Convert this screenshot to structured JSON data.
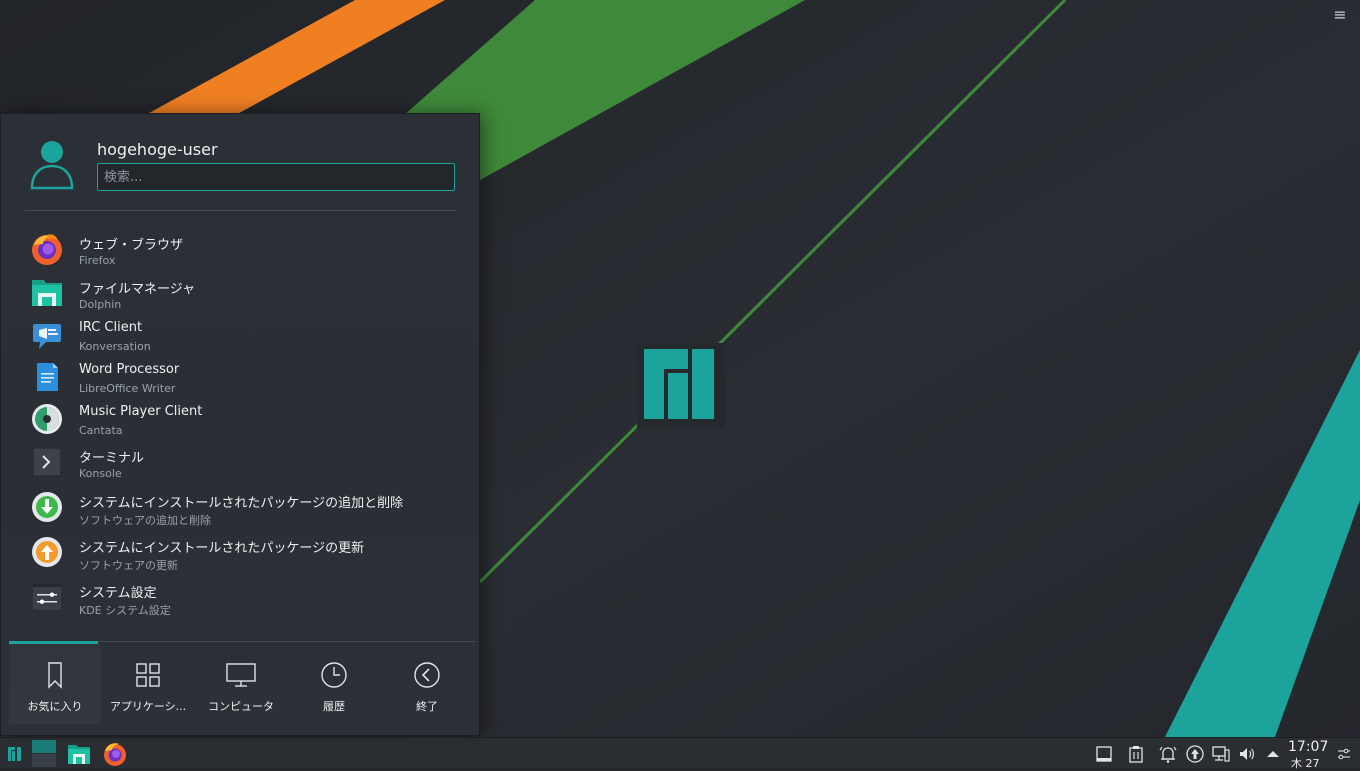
{
  "launcher": {
    "user_name": "hogehoge-user",
    "search_placeholder": "検索...",
    "apps": [
      {
        "name": "ウェブ・ブラウザ",
        "subtitle": "Firefox",
        "icon": "firefox-icon"
      },
      {
        "name": "ファイルマネージャ",
        "subtitle": "Dolphin",
        "icon": "folder-icon"
      },
      {
        "name": "IRC Client",
        "subtitle": "Konversation",
        "icon": "chat-icon"
      },
      {
        "name": "Word Processor",
        "subtitle": "LibreOffice Writer",
        "icon": "document-icon"
      },
      {
        "name": "Music Player Client",
        "subtitle": "Cantata",
        "icon": "music-icon"
      },
      {
        "name": "ターミナル",
        "subtitle": "Konsole",
        "icon": "terminal-icon"
      },
      {
        "name": "システムにインストールされたパッケージの追加と削除",
        "subtitle": "ソフトウェアの追加と削除",
        "icon": "package-install-icon"
      },
      {
        "name": "システムにインストールされたパッケージの更新",
        "subtitle": "ソフトウェアの更新",
        "icon": "package-update-icon"
      },
      {
        "name": "システム設定",
        "subtitle": "KDE システム設定",
        "icon": "settings-icon"
      }
    ],
    "tabs": [
      {
        "label": "お気に入り",
        "icon": "bookmark-icon",
        "active": true
      },
      {
        "label": "アプリケーシ...",
        "icon": "grid-icon",
        "active": false
      },
      {
        "label": "コンピュータ",
        "icon": "monitor-icon",
        "active": false
      },
      {
        "label": "履歴",
        "icon": "clock-icon",
        "active": false
      },
      {
        "label": "終了",
        "icon": "back-arrow-icon",
        "active": false
      }
    ]
  },
  "taskbar": {
    "clock_time": "17:07",
    "clock_date": "木 27",
    "launchers": [
      "manjaro-menu-icon",
      "desktop-pager-icon",
      "file-manager-icon",
      "firefox-icon"
    ],
    "tray": [
      "show-desktop-icon",
      "clipboard-icon",
      "notifications-icon",
      "updates-icon",
      "network-icon",
      "volume-icon",
      "expand-tray-icon",
      "tray-settings-icon"
    ]
  },
  "colors": {
    "accent": "#1ba39c",
    "orange_stripe": "#f07f22",
    "green_stripe": "#3f8a3a",
    "background": "#23262b"
  }
}
